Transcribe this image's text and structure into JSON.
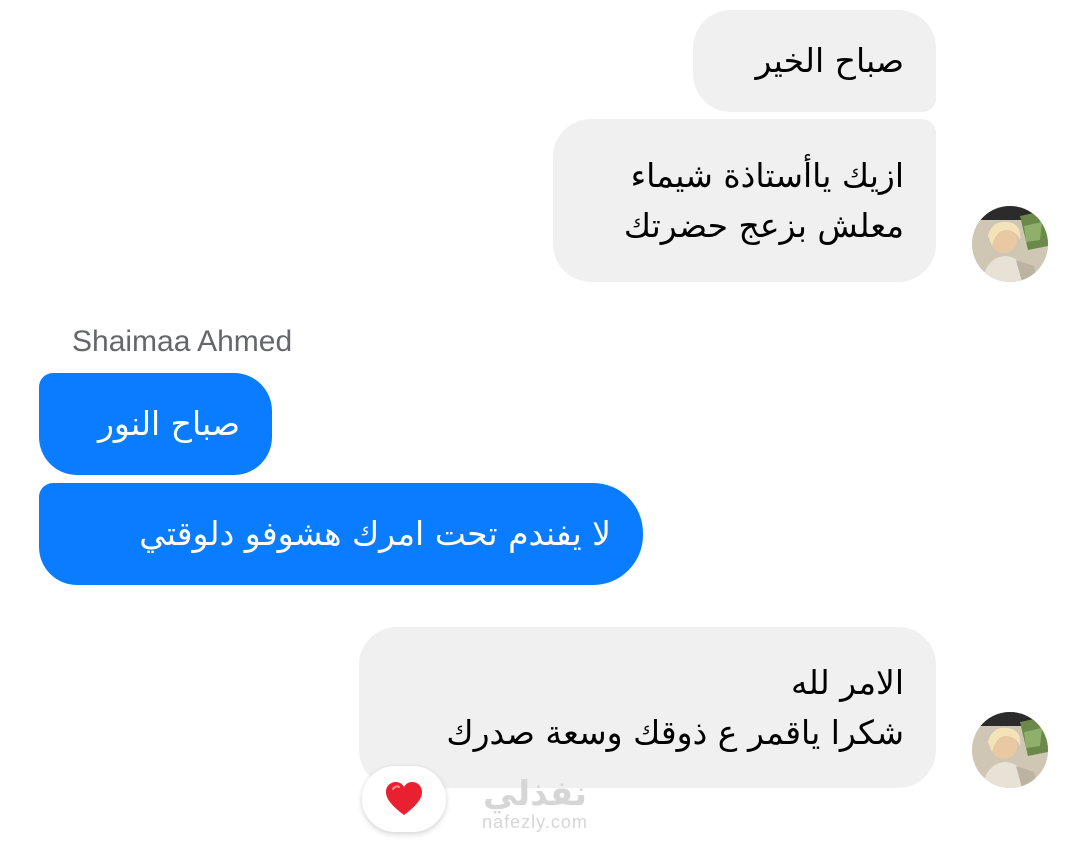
{
  "messages": [
    {
      "direction": "incoming",
      "lines": [
        "صباح الخير"
      ]
    },
    {
      "direction": "incoming",
      "lines": [
        "ازيك ياأستاذة شيماء",
        "معلش بزعج حضرتك"
      ]
    },
    {
      "direction": "outgoing",
      "sender": "Shaimaa Ahmed",
      "lines": [
        "صباح النور"
      ]
    },
    {
      "direction": "outgoing",
      "lines": [
        "لا يفندم تحت امرك هشوفو دلوقتي"
      ]
    },
    {
      "direction": "incoming",
      "lines": [
        "الامر لله",
        "شكرا ياقمر ع ذوقك وسعة صدرك"
      ],
      "reaction": "heart-icon"
    }
  ],
  "watermark": {
    "arabic": "نفذلي",
    "latin": "nafezly.com"
  },
  "colors": {
    "incoming_bubble": "#f0f0f0",
    "outgoing_bubble": "#0a7cff",
    "outgoing_text": "#ffffff",
    "sender_name": "#65676b",
    "heart": "#e8202f"
  }
}
